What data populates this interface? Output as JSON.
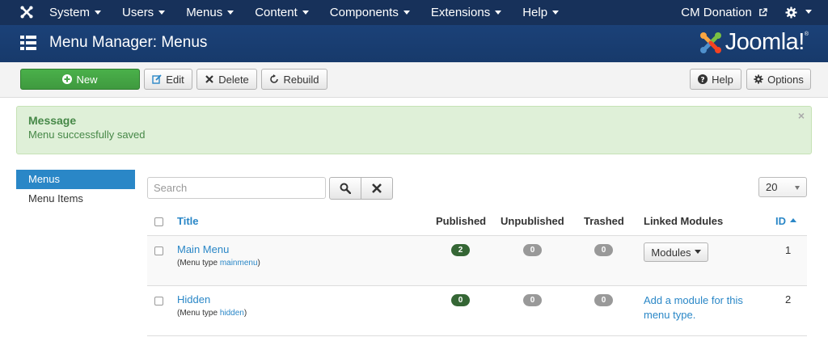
{
  "topbar": {
    "menu": [
      {
        "label": "System"
      },
      {
        "label": "Users"
      },
      {
        "label": "Menus"
      },
      {
        "label": "Content"
      },
      {
        "label": "Components"
      },
      {
        "label": "Extensions"
      },
      {
        "label": "Help"
      }
    ],
    "site_label": "CM Donation"
  },
  "header": {
    "title": "Menu Manager: Menus",
    "brand": "Joomla!"
  },
  "toolbar": {
    "new_label": "New",
    "edit_label": "Edit",
    "delete_label": "Delete",
    "rebuild_label": "Rebuild",
    "help_label": "Help",
    "options_label": "Options"
  },
  "message": {
    "heading": "Message",
    "text": "Menu successfully saved",
    "close": "×"
  },
  "sidebar": {
    "items": [
      {
        "label": "Menus",
        "active": true
      },
      {
        "label": "Menu Items",
        "active": false
      }
    ]
  },
  "filters": {
    "search_placeholder": "Search",
    "search_value": "",
    "limit": "20"
  },
  "table": {
    "headers": {
      "title": "Title",
      "published": "Published",
      "unpublished": "Unpublished",
      "trashed": "Trashed",
      "linked_modules": "Linked Modules",
      "id": "ID"
    },
    "rows": [
      {
        "title": "Main Menu",
        "menu_type_prefix": "(Menu type ",
        "menu_type": "mainmenu",
        "menu_type_suffix": ")",
        "published": "2",
        "unpublished": "0",
        "trashed": "0",
        "modules_label": "Modules",
        "id": "1"
      },
      {
        "title": "Hidden",
        "menu_type_prefix": "(Menu type ",
        "menu_type": "hidden",
        "menu_type_suffix": ")",
        "published": "0",
        "unpublished": "0",
        "trashed": "0",
        "add_module_label": "Add a module for this menu type.",
        "id": "2"
      }
    ]
  },
  "colors": {
    "navbar": "#17315a",
    "header": "#1b4178",
    "accent": "#2a87c7",
    "new_button": "#46a546",
    "success_bg": "#dff0d8",
    "badge_published": "#356635"
  },
  "icons": {
    "brand": "joomla-icon",
    "header": "menu-list-icon",
    "site": "external-link-icon",
    "settings": "gear-icon"
  }
}
